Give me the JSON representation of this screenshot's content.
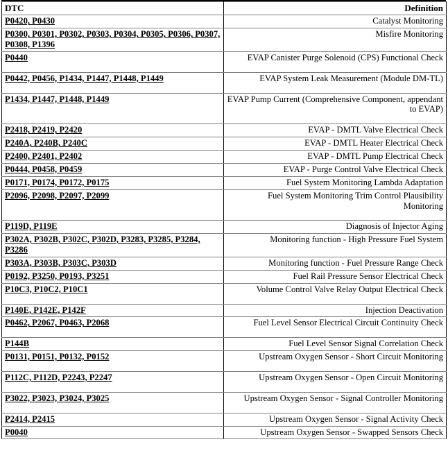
{
  "table": {
    "headers": {
      "dtc": "DTC",
      "definition": "Definition"
    },
    "rows": [
      {
        "dtc": "P0420, P0430",
        "definition": "Catalyst Monitoring",
        "tall": false
      },
      {
        "dtc": "P0300, P0301, P0302, P0303, P0304, P0305, P0306, P0307, P0308, P1396",
        "definition": "Misfire Monitoring",
        "tall": false
      },
      {
        "dtc": "P0440",
        "definition": "EVAP Canister Purge Solenoid (CPS) Functional Check",
        "tall": true
      },
      {
        "dtc": "P0442, P0456, P1434, P1447, P1448, P1449",
        "definition": "EVAP System Leak Measurement (Module DM-TL)",
        "tall": true
      },
      {
        "dtc": "P1434, P1447, P1448, P1449",
        "definition": "EVAP Pump Current (Comprehensive Component, appendant to EVAP)",
        "tall": true
      },
      {
        "dtc": "P2418, P2419, P2420",
        "definition": "EVAP - DMTL Valve Electrical Check",
        "tall": false
      },
      {
        "dtc": "P240A, P240B, P240C",
        "definition": "EVAP - DMTL Heater Electrical Check",
        "tall": false
      },
      {
        "dtc": "P2400, P2401, P2402",
        "definition": "EVAP - DMTL Pump Electrical Check",
        "tall": false
      },
      {
        "dtc": "P0444, P0458, P0459",
        "definition": "EVAP - Purge Control Valve Electrical Check",
        "tall": false
      },
      {
        "dtc": "P0171, P0174, P0172, P0175",
        "definition": "Fuel System Monitoring Lambda Adaptation",
        "tall": false
      },
      {
        "dtc": "P2096, P2098, P2097, P2099",
        "definition": "Fuel System Monitoring Trim Control Plausibility Monitoring",
        "tall": true
      },
      {
        "dtc": "P119D, P119E",
        "definition": "Diagnosis of Injector Aging",
        "tall": false
      },
      {
        "dtc": "P302A, P302B, P302C, P302D, P3283, P3285, P3284, P3286",
        "definition": "Monitoring function - High Pressure Fuel System",
        "tall": false
      },
      {
        "dtc": "P303A, P303B, P303C, P303D",
        "definition": "Monitoring function - Fuel Pressure Range Check",
        "tall": false
      },
      {
        "dtc": "P0192, P3250, P0193, P3251",
        "definition": "Fuel Rail Pressure Sensor Electrical Check",
        "tall": false
      },
      {
        "dtc": "P10C3, P10C2, P10C1",
        "definition": "Volume Control Valve Relay Output Electrical Check",
        "tall": true
      },
      {
        "dtc": "P140E, P142E, P142F",
        "definition": "Injection Deactivation",
        "tall": false
      },
      {
        "dtc": "P0462, P2067, P0463, P2068",
        "definition": "Fuel Level Sensor Electrical Circuit Continuity Check",
        "tall": true
      },
      {
        "dtc": "P144B",
        "definition": "Fuel Level Sensor Signal Correlation Check",
        "tall": false
      },
      {
        "dtc": "P0131, P0151, P0132, P0152",
        "definition": "Upstream Oxygen Sensor - Short Circuit Monitoring",
        "tall": true
      },
      {
        "dtc": "P112C, P112D, P2243, P2247",
        "definition": "Upstream Oxygen Sensor - Open Circuit Monitoring",
        "tall": true
      },
      {
        "dtc": "P3022, P3023, P3024, P3025",
        "definition": "Upstream Oxygen Sensor - Signal Controller Monitoring",
        "tall": true
      },
      {
        "dtc": "P2414, P2415",
        "definition": "Upstream Oxygen Sensor - Signal Activity Check",
        "tall": false
      },
      {
        "dtc": "P0040",
        "definition": "Upstream Oxygen Sensor - Swapped Sensors Check",
        "tall": false
      }
    ]
  }
}
